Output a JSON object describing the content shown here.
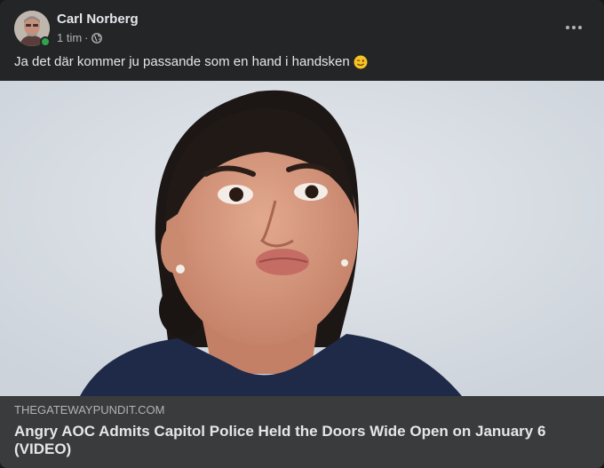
{
  "post": {
    "author": "Carl Norberg",
    "time": "1 tim",
    "separator": "·",
    "audience_icon": "globe-icon",
    "text": "Ja det där kommer ju passande som en hand i handsken",
    "emoji": "winking-face-emoji",
    "more_icon": "more-options-icon"
  },
  "link_preview": {
    "domain": "THEGATEWAYPUNDIT.COM",
    "title": "Angry AOC Admits Capitol Police Held the Doors Wide Open on January 6 (VIDEO)"
  },
  "colors": {
    "card": "#242526",
    "page": "#18191a",
    "link_box": "#3a3b3c",
    "primary_text": "#e4e6eb",
    "secondary_text": "#b0b3b8",
    "online": "#31a24c"
  }
}
